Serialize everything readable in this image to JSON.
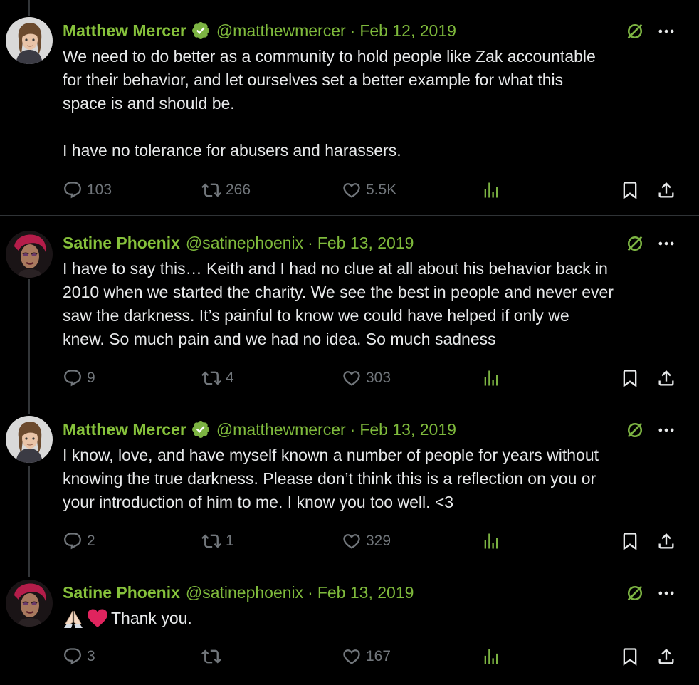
{
  "colors": {
    "background": "#000000",
    "text": "#e7e9ea",
    "muted": "#71767b",
    "accent_green": "#7fba3c",
    "verified_green": "#7cb342",
    "heart_red": "#e0245e"
  },
  "tweets": [
    {
      "author": "Matthew Mercer",
      "verified": true,
      "handle": "@matthewmercer",
      "separator": "·",
      "date": "Feb 12, 2019",
      "text": "We need to do better as a community to hold people like Zak accountable\nfor their behavior, and let ourselves set a better example for what this\nspace is and should be.\n\nI have no tolerance for abusers and harassers.",
      "replies": "103",
      "retweets": "266",
      "likes": "5.5K",
      "icons": [
        "grok-icon",
        "more-icon",
        "reply-icon",
        "retweet-icon",
        "like-icon",
        "views-icon",
        "bookmark-icon",
        "share-icon"
      ]
    },
    {
      "author": "Satine Phoenix",
      "verified": false,
      "handle": "@satinephoenix",
      "separator": "·",
      "date": "Feb 13, 2019",
      "text": "I have to say this… Keith and I had no clue at all about his behavior back in\n2010 when we started the charity. We see the best in people and never ever\nsaw the darkness. It’s painful to know we could have helped if only we\nknew. So much pain and we had no idea. So much sadness",
      "replies": "9",
      "retweets": "4",
      "likes": "303"
    },
    {
      "author": "Matthew Mercer",
      "verified": true,
      "handle": "@matthewmercer",
      "separator": "·",
      "date": "Feb 13, 2019",
      "text": "I know, love, and have myself known a number of people for years without\nknowing the true darkness. Please don’t think this is a reflection on you or\nyour introduction of him to me. I know you too well. <3",
      "replies": "2",
      "retweets": "1",
      "likes": "329"
    },
    {
      "author": "Satine Phoenix",
      "verified": false,
      "handle": "@satinephoenix",
      "separator": "·",
      "date": "Feb 13, 2019",
      "emoji": [
        "folded-hands-emoji",
        "red-heart-emoji"
      ],
      "text": "Thank you.",
      "replies": "3",
      "retweets": "",
      "likes": "167"
    }
  ]
}
